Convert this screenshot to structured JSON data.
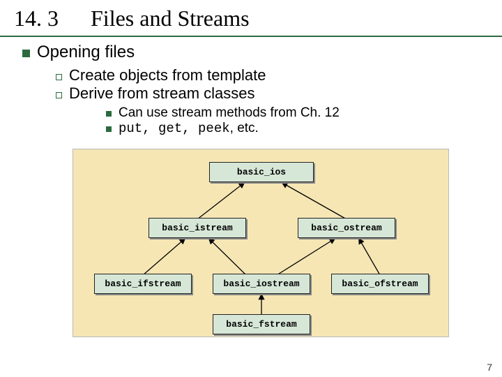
{
  "section_number": "14. 3",
  "section_title": "Files and Streams",
  "h1": "Opening files",
  "sub_a": "Create objects from template",
  "sub_b": "Derive from stream classes",
  "sub_c": "Can use stream methods from Ch. 12",
  "sub_d_code": "put, get, peek",
  "sub_d_tail": ", etc.",
  "diagram": {
    "ios": "basic_ios",
    "istream": "basic_istream",
    "ostream": "basic_ostream",
    "ifstream": "basic_ifstream",
    "iostream": "basic_iostream",
    "ofstream": "basic_ofstream",
    "fstream": "basic_fstream"
  },
  "page_number": "7"
}
